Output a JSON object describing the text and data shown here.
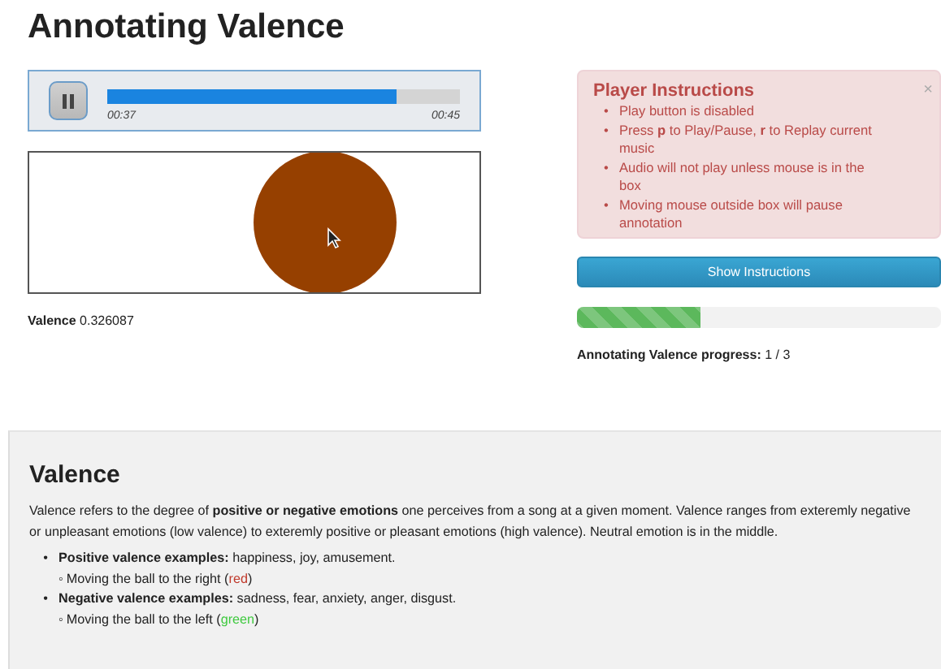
{
  "page": {
    "title": "Annotating Valence"
  },
  "player": {
    "playing": true,
    "progress": {
      "level": 0.82
    },
    "elapsed": "00:37",
    "duration": "00:45"
  },
  "valence_reading": {
    "label": "Valence",
    "value": "0.326087"
  },
  "instructions": {
    "title": "Player Instructions",
    "close": "×",
    "marker": "•",
    "items": [
      "Play button is disabled",
      "Press **p** to Play/Pause, **r** to Replay current music",
      "Audio will not play unless mouse is in the box",
      "Moving mouse outside box will pause annotation"
    ]
  },
  "show_button": {
    "label": "Show Instructions"
  },
  "annotation_progress": {
    "level": 0.34,
    "label": "Annotating Valence progress:",
    "value": "1 / 3"
  },
  "info": {
    "title": "Valence",
    "paragraph": "Valence refers to the degree of **positive or negative emotions** one perceives from a song at a given moment. Valence ranges from exteremly negative or unpleasant emotions (low valence) to exteremly positive or pleasant emotions (high valence). Neutral emotion is in the middle.",
    "marker": "•",
    "sub_marker": "◦",
    "examples": [
      {
        "label": "Positive valence examples:",
        "text": "happiness, joy, amusement.",
        "children": [
          {
            "before": "Moving the ball to the right (",
            "word": "red",
            "color": "#c0392b",
            "after": ")"
          }
        ]
      },
      {
        "label": "Negative valence examples:",
        "text": "sadness, fear, anxiety, anger, disgust.",
        "children": [
          {
            "before": "Moving the ball to the left (",
            "word": "green",
            "color": "#3ec93e",
            "after": ")"
          }
        ]
      }
    ]
  }
}
